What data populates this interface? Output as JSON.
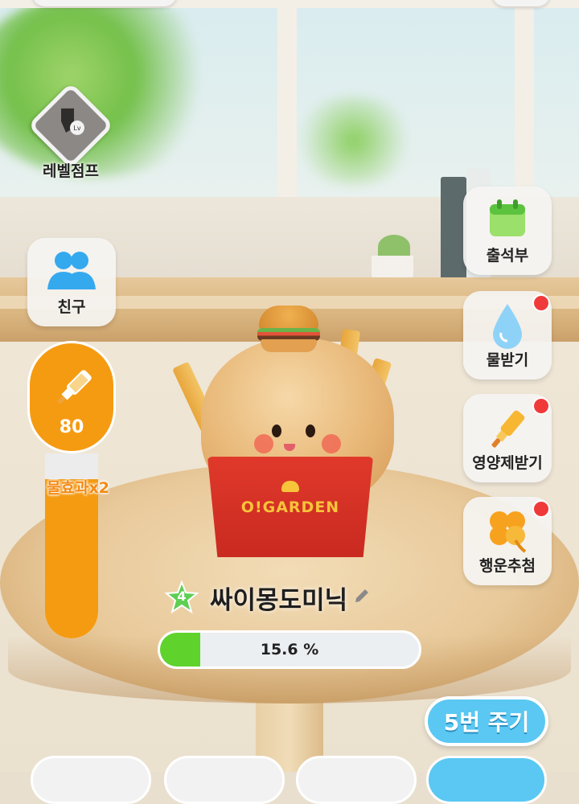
{
  "side_left": {
    "level_jump": {
      "label": "레벨점프",
      "badge": "Lv",
      "icon": "level-jump-icon"
    },
    "friends": {
      "label": "친구",
      "icon": "friends-icon"
    }
  },
  "side_right": {
    "attendance": {
      "label": "출석부",
      "icon": "calendar-icon"
    },
    "water": {
      "label": "물받기",
      "icon": "water-drop-icon",
      "has_alert": true
    },
    "nutrient": {
      "label": "영양제받기",
      "icon": "nutrient-bottle-icon",
      "has_alert": true
    },
    "lucky": {
      "label": "행운추첨",
      "icon": "clover-icon",
      "has_alert": true
    }
  },
  "gauge": {
    "value": "80",
    "fill_fraction": 0.86,
    "multiplier_label": "물효과x2",
    "color": "#f59b12"
  },
  "character": {
    "level": "4",
    "name": "싸이몽도미닉",
    "box_logo": "O!GARDEN"
  },
  "progress": {
    "percent": 15.6,
    "label": "15.6 %",
    "fill_color": "#5fd22c"
  },
  "give_button": {
    "label": "5번 주기",
    "color": "#5ac8f2"
  },
  "alert_color": "#f03a3a"
}
